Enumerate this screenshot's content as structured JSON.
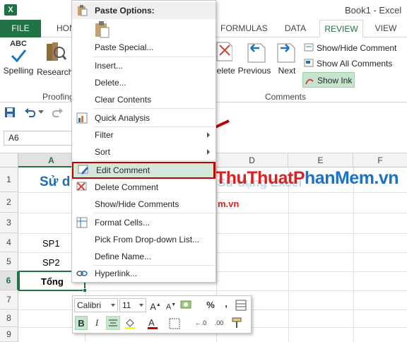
{
  "titlebar": {
    "app_icon": "X",
    "title": "Book1 - Excel"
  },
  "tabs": {
    "file": "FILE",
    "home": "HOM",
    "formulas": "FORMULAS",
    "data": "DATA",
    "review": "REVIEW",
    "view": "VIEW"
  },
  "ribbon": {
    "spelling": "Spelling",
    "research": "Research",
    "proofing": "Proofing",
    "delete": "Delete",
    "previous": "Previous",
    "next": "Next",
    "show_hide_comment": "Show/Hide Comment",
    "show_all_comments": "Show All Comments",
    "show_ink": "Show Ink",
    "comments": "Comments",
    "abc": "ABC"
  },
  "namebox": "A6",
  "columns": [
    "A",
    "D",
    "E",
    "F"
  ],
  "rows": [
    "1",
    "2",
    "3",
    "4",
    "5",
    "6",
    "7",
    "8",
    "9"
  ],
  "cells": {
    "a1": "Sử d",
    "line1_tail": "Sử dụng Excel",
    "a4": "SP1",
    "a5": "SP2",
    "a6": "Tổng",
    "row2_tail": "m.vn"
  },
  "watermark": "ThuThuatPhanMem.vn",
  "menu": {
    "paste_options": "Paste Options:",
    "paste_special": "Paste Special...",
    "insert": "Insert...",
    "delete": "Delete...",
    "clear_contents": "Clear Contents",
    "quick_analysis": "Quick Analysis",
    "filter": "Filter",
    "sort": "Sort",
    "edit_comment": "Edit Comment",
    "delete_comment": "Delete Comment",
    "show_hide_comments": "Show/Hide Comments",
    "format_cells": "Format Cells...",
    "pick_from_list": "Pick From Drop-down List...",
    "define_name": "Define Name...",
    "hyperlink": "Hyperlink..."
  },
  "mini": {
    "font": "Calibri",
    "size": "11",
    "bold": "B",
    "italic": "I",
    "percent": "%",
    "comma": ","
  },
  "colors": {
    "excel_green": "#217346",
    "highlight": "#d4e8d9",
    "annotation_red": "#c00000",
    "watermark_red": "#e02020",
    "watermark_blue": "#1a73c8"
  }
}
